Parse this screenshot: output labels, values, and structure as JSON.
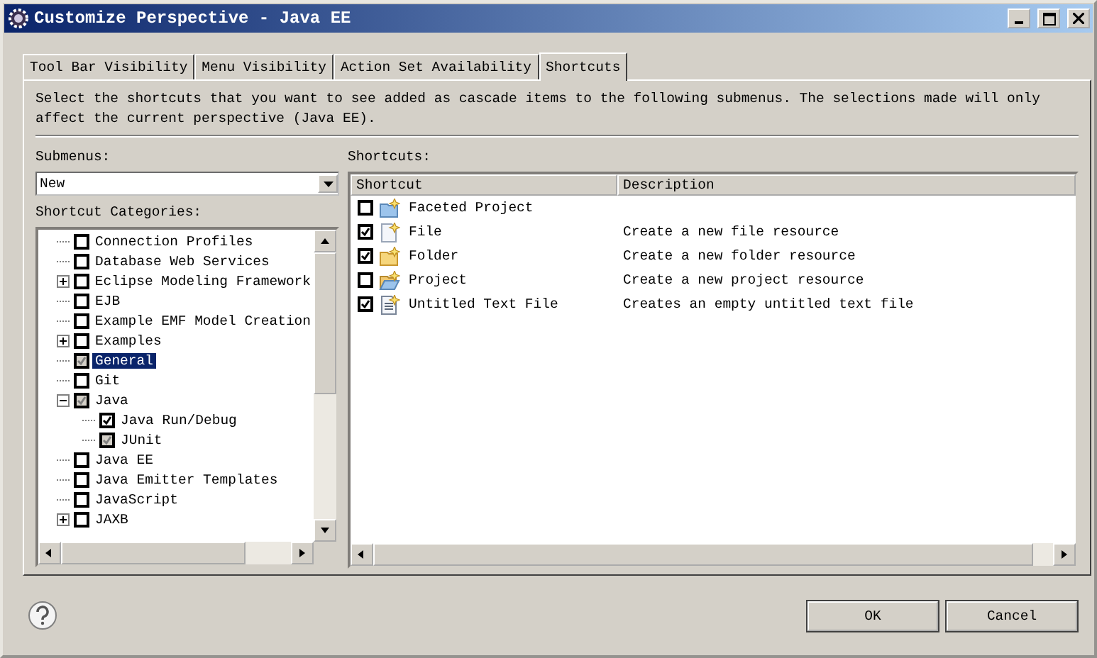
{
  "window": {
    "title": "Customize Perspective - Java EE"
  },
  "tabs": [
    {
      "label": "Tool Bar Visibility",
      "selected": false
    },
    {
      "label": "Menu Visibility",
      "selected": false
    },
    {
      "label": "Action Set Availability",
      "selected": false
    },
    {
      "label": "Shortcuts",
      "selected": true
    }
  ],
  "description": "Select the shortcuts that you want to see added as cascade items to the following submenus.  The selections made will only affect the current perspective (Java EE).",
  "submenus": {
    "label": "Submenus:",
    "value": "New"
  },
  "categories": {
    "label": "Shortcut Categories:",
    "items": [
      {
        "label": "Connection Profiles",
        "checked": false,
        "grayed": false,
        "selected": false
      },
      {
        "label": "Database Web Services",
        "checked": false,
        "grayed": false,
        "selected": false
      },
      {
        "label": "Eclipse Modeling Framework",
        "checked": false,
        "grayed": false,
        "selected": false,
        "expanded": false
      },
      {
        "label": "EJB",
        "checked": false,
        "grayed": false,
        "selected": false
      },
      {
        "label": "Example EMF Model Creation",
        "checked": false,
        "grayed": false,
        "selected": false
      },
      {
        "label": "Examples",
        "checked": false,
        "grayed": false,
        "selected": false,
        "expanded": false
      },
      {
        "label": "General",
        "checked": true,
        "grayed": true,
        "selected": true
      },
      {
        "label": "Git",
        "checked": false,
        "grayed": false,
        "selected": false
      },
      {
        "label": "Java",
        "checked": true,
        "grayed": true,
        "selected": false,
        "expanded": true,
        "children": [
          {
            "label": "Java Run/Debug",
            "checked": true,
            "grayed": false,
            "selected": false
          },
          {
            "label": "JUnit",
            "checked": true,
            "grayed": true,
            "selected": false
          }
        ]
      },
      {
        "label": "Java EE",
        "checked": false,
        "grayed": false,
        "selected": false
      },
      {
        "label": "Java Emitter Templates",
        "checked": false,
        "grayed": false,
        "selected": false
      },
      {
        "label": "JavaScript",
        "checked": false,
        "grayed": false,
        "selected": false
      },
      {
        "label": "JAXB",
        "checked": false,
        "grayed": false,
        "selected": false,
        "expanded": false
      }
    ]
  },
  "shortcuts": {
    "label": "Shortcuts:",
    "columns": [
      "Shortcut",
      "Description"
    ],
    "rows": [
      {
        "kind": "project",
        "name": "Faceted Project",
        "description": "",
        "checked": false
      },
      {
        "kind": "file",
        "name": "File",
        "description": "Create a new file resource",
        "checked": true
      },
      {
        "kind": "folder",
        "name": "Folder",
        "description": "Create a new folder resource",
        "checked": true
      },
      {
        "kind": "openfolder",
        "name": "Project",
        "description": "Create a new project resource",
        "checked": false
      },
      {
        "kind": "textfile",
        "name": "Untitled Text File",
        "description": "Creates an empty untitled text file",
        "checked": true
      }
    ]
  },
  "buttons": [
    "OK",
    "Cancel"
  ]
}
